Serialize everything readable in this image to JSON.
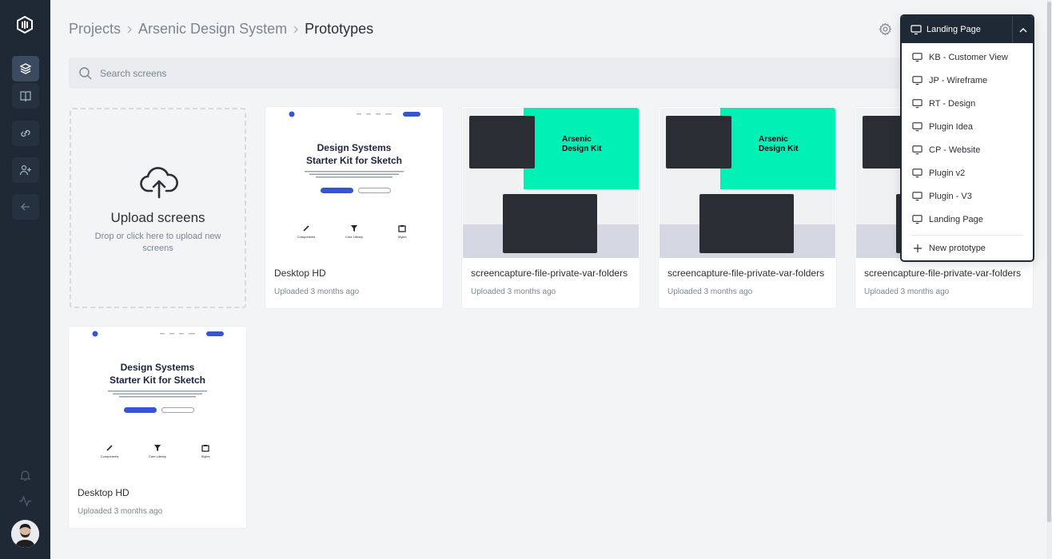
{
  "icons": {
    "logo": "app-logo-icon",
    "layers": "layers-icon",
    "book": "book-icon",
    "link": "link-icon",
    "add_user": "add-user-icon",
    "back": "arrow-left-icon",
    "bell": "bell-icon",
    "activity": "activity-icon",
    "settings": "gear-icon",
    "search": "search-icon",
    "upload": "cloud-upload-icon",
    "monitor": "monitor-icon",
    "chevron": "chevron-up-icon",
    "plus": "plus-icon"
  },
  "colors": {
    "sidebar": "#1f2835",
    "background": "#f3f4f5",
    "accent_green": "#00f0b5",
    "primary_blue": "#3555d8"
  },
  "breadcrumb": [
    "Projects",
    "Arsenic Design System",
    "Prototypes"
  ],
  "search": {
    "placeholder": "Search screens"
  },
  "upload": {
    "title": "Upload screens",
    "subtitle": "Drop or click here to upload new screens"
  },
  "screens": [
    {
      "name": "Desktop HD",
      "meta": "Uploaded 3 months ago",
      "thumb": "design"
    },
    {
      "name": "screencapture-file-private-var-folders",
      "meta": "Uploaded 3 months ago",
      "thumb": "capture"
    },
    {
      "name": "screencapture-file-private-var-folders",
      "meta": "Uploaded 3 months ago",
      "thumb": "capture"
    },
    {
      "name": "screencapture-file-private-var-folders",
      "meta": "Uploaded 3 months ago",
      "thumb": "capture"
    },
    {
      "name": "Desktop HD",
      "meta": "Uploaded 3 months ago",
      "thumb": "design"
    }
  ],
  "thumbs": {
    "design_heading_1": "Design Systems",
    "design_heading_2": "Starter Kit for Sketch",
    "design_features": [
      "Components",
      "Core Library",
      "Styles"
    ],
    "capture_heading_1": "Arsenic",
    "capture_heading_2": "Design Kit"
  },
  "dropdown": {
    "selected": "Landing Page",
    "items": [
      "KB - Customer View",
      "JP - Wireframe",
      "RT - Design",
      "Plugin Idea",
      "CP - Website",
      "Plugin v2",
      "Plugin - V3",
      "Landing Page"
    ],
    "new_label": "New prototype"
  }
}
